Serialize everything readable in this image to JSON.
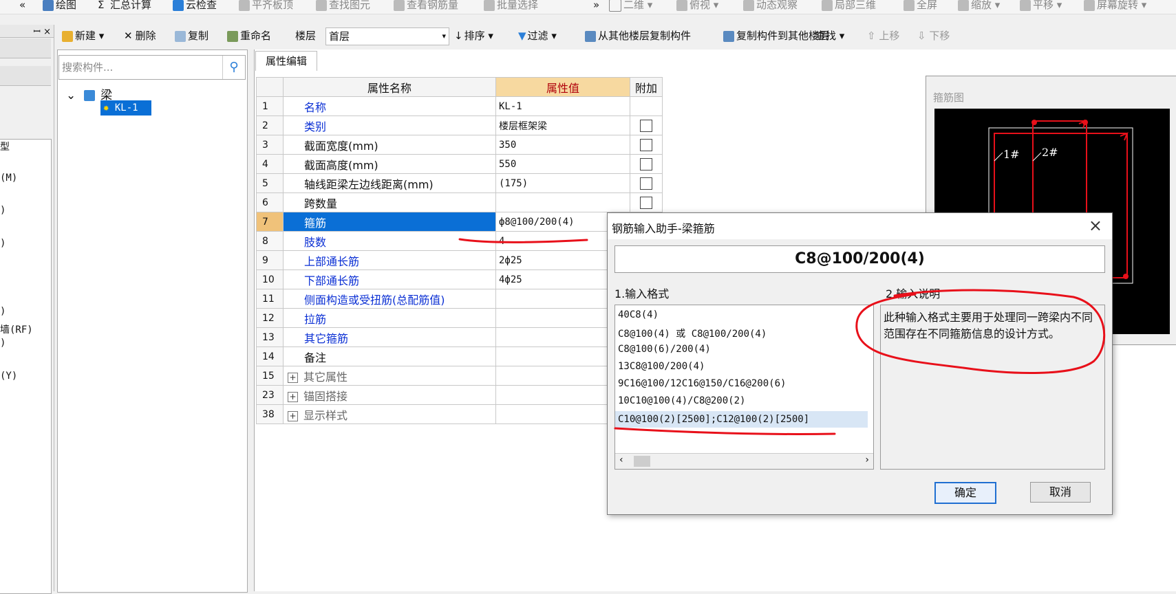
{
  "toolbar1": {
    "items": [
      "« ",
      "绘图",
      "Σ",
      "汇总计算",
      "云检查",
      "平齐板顶",
      "查找图元",
      "查看钢筋量",
      "批量选择",
      "»",
      "二维 ▾",
      "俯视 ▾",
      "动态观察",
      "局部三维",
      "全屏",
      "缩放 ▾",
      "平移 ▾",
      "屏幕旋转 ▾"
    ]
  },
  "left_panel": {
    "pin": "ꟷ ×",
    "items": [
      "型",
      "(M)",
      ")",
      ")",
      ")",
      "墙(RF)",
      ")",
      "(Y)"
    ]
  },
  "toolbar2": {
    "new": "新建 ▾",
    "delete": "删除",
    "copy": "复制",
    "rename": "重命名",
    "floor_label": "楼层",
    "floor_value": "首层",
    "sort": "排序 ▾",
    "filter": "过滤 ▾",
    "copy_from": "从其他楼层复制构件",
    "copy_to": "复制构件到其他楼层",
    "find": "查找 ▾",
    "move_up": "上移",
    "move_down": "下移"
  },
  "tree": {
    "search_placeholder": "搜索构件...",
    "root": "梁",
    "child": "KL-1"
  },
  "prop": {
    "tab": "属性编辑",
    "headers": {
      "name": "属性名称",
      "value": "属性值",
      "extra": "附加"
    },
    "rows": [
      {
        "num": "1",
        "name": "名称",
        "value": "KL-1"
      },
      {
        "num": "2",
        "name": "类别",
        "value": "楼层框架梁"
      },
      {
        "num": "3",
        "name": "截面宽度(mm)",
        "value": "350"
      },
      {
        "num": "4",
        "name": "截面高度(mm)",
        "value": "550"
      },
      {
        "num": "5",
        "name": "轴线距梁左边线距离(mm)",
        "value": "(175)"
      },
      {
        "num": "6",
        "name": "跨数量",
        "value": ""
      },
      {
        "num": "7",
        "name": "箍筋",
        "value": "ф8@100/200(4)"
      },
      {
        "num": "8",
        "name": "肢数",
        "value": "4"
      },
      {
        "num": "9",
        "name": "上部通长筋",
        "value": "2ф25"
      },
      {
        "num": "10",
        "name": "下部通长筋",
        "value": "4ф25"
      },
      {
        "num": "11",
        "name": "侧面构造或受扭筋(总配筋值)",
        "value": ""
      },
      {
        "num": "12",
        "name": "拉筋",
        "value": ""
      },
      {
        "num": "13",
        "name": "其它箍筋",
        "value": ""
      },
      {
        "num": "14",
        "name": "备注",
        "value": ""
      },
      {
        "num": "15",
        "name": "其它属性",
        "value": ""
      },
      {
        "num": "23",
        "name": "锚固搭接",
        "value": ""
      },
      {
        "num": "38",
        "name": "显示样式",
        "value": ""
      }
    ]
  },
  "preview": {
    "title": "箍筋图",
    "label1": "1#",
    "label2": "2#"
  },
  "dialog": {
    "title": "钢筋输入助手-梁箍筋",
    "close": "×",
    "formula": "C8@100/200(4)",
    "format_label": "1.输入格式",
    "desc_label": "2.输入说明",
    "formats": [
      "40C8(4)",
      "C8@100(4) 或 C8@100/200(4)",
      "C8@100(6)/200(4)",
      "13C8@100/200(4)",
      "9C16@100/12C16@150/C16@200(6)",
      "10C10@100(4)/C8@200(2)",
      "C10@100(2)[2500];C12@100(2)[2500]"
    ],
    "description": "此种输入格式主要用于处理同一跨梁内不同范围存在不同箍筋信息的设计方式。",
    "ok": "确定",
    "cancel": "取消"
  },
  "colors": {
    "selection_blue": "#0a6fd6",
    "value_header": "#f7d9a0",
    "annotation_red": "#e8101a",
    "link_blue": "#0a2fd4"
  }
}
